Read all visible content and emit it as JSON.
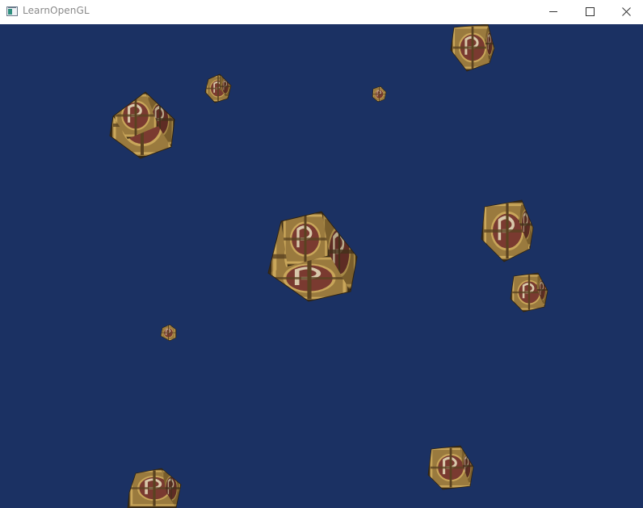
{
  "window": {
    "title": "LearnOpenGL",
    "app_icon": "opengl-window-icon",
    "controls": {
      "minimize_icon": "minimize-icon",
      "maximize_icon": "maximize-icon",
      "close_icon": "close-icon"
    }
  },
  "scene": {
    "background_color": "#1b3163",
    "cube_count": 10,
    "cube_texture": "wooden-crate-with-emblem",
    "colors": {
      "wood_light": "#b8904a",
      "wood_dark": "#6b5028",
      "emblem_red": "#7a3a30",
      "emblem_light": "#c8b69a",
      "edge": "#3a2c16"
    }
  }
}
